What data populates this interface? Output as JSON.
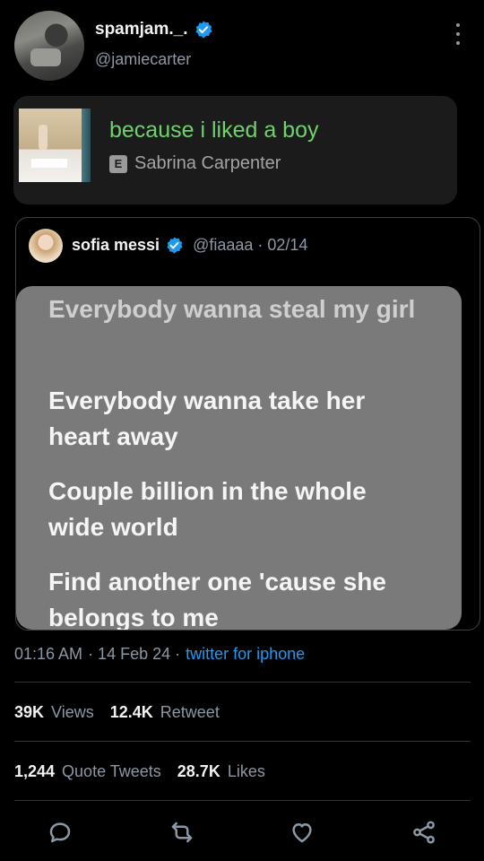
{
  "author": {
    "display_name": "spamjam._.",
    "handle": "@jamiecarter"
  },
  "song": {
    "title": "because i liked a boy",
    "explicit_badge": "E",
    "artist": "Sabrina Carpenter"
  },
  "quoted_tweet": {
    "name": "sofia messi",
    "meta": "@fiaaaa · 02/14",
    "lyrics": [
      "Everybody wanna steal my girl",
      "Everybody wanna take her heart away",
      "Couple billion in the whole wide world",
      "Find another one 'cause she belongs to me"
    ]
  },
  "timestamp": {
    "time": "01:16 AM",
    "date": "· 14 Feb 24 ·",
    "source": "twitter for iphone"
  },
  "stats": {
    "views_num": "39K",
    "views_label": "Views",
    "retweets_num": "12.4K",
    "retweets_label": "Retweet",
    "quotes_num": "1,244",
    "quotes_label": "Quote Tweets",
    "likes_num": "28.7K",
    "likes_label": "Likes"
  },
  "colors": {
    "background": "#000000",
    "accent_blue": "#1d9bf0",
    "song_green": "#6ed36a",
    "lyrics_card": "#7a7a7a",
    "muted_text": "#8b98a5"
  },
  "icons": [
    "verified-badge-icon",
    "more-options-icon",
    "explicit-icon",
    "reply-icon",
    "retweet-icon",
    "like-icon",
    "share-icon"
  ]
}
